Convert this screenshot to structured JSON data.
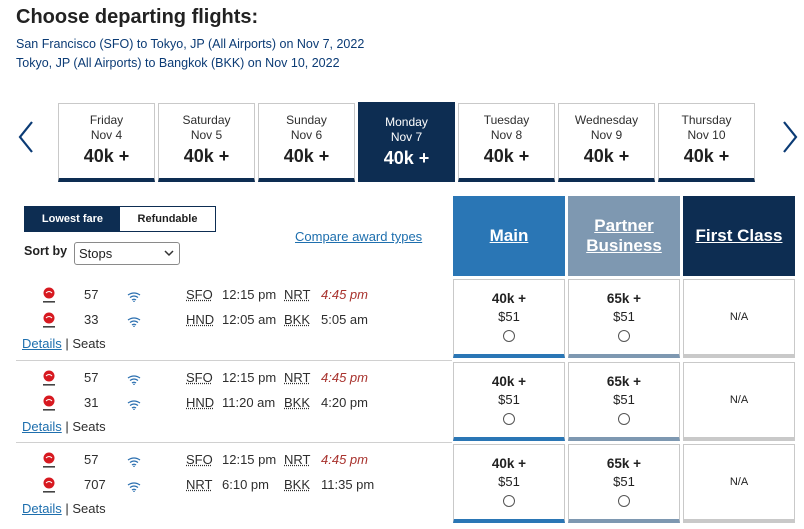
{
  "header": {
    "title": "Choose departing flights:",
    "route_1": "San Francisco (SFO) to Tokyo, JP (All Airports) on Nov 7, 2022",
    "route_2": "Tokyo, JP (All Airports) to Bangkok (BKK) on Nov 10, 2022"
  },
  "dates": [
    {
      "day": "Friday",
      "date": "Nov 4",
      "price": "40k +"
    },
    {
      "day": "Saturday",
      "date": "Nov 5",
      "price": "40k +"
    },
    {
      "day": "Sunday",
      "date": "Nov 6",
      "price": "40k +"
    },
    {
      "day": "Monday",
      "date": "Nov 7",
      "price": "40k +"
    },
    {
      "day": "Tuesday",
      "date": "Nov 8",
      "price": "40k +"
    },
    {
      "day": "Wednesday",
      "date": "Nov 9",
      "price": "40k +"
    },
    {
      "day": "Thursday",
      "date": "Nov 10",
      "price": "40k +"
    }
  ],
  "selected_date_index": 3,
  "fare_toggle": {
    "lowest": "Lowest fare",
    "refundable": "Refundable"
  },
  "sort": {
    "label": "Sort by",
    "value": "Stops"
  },
  "compare_link": "Compare award types",
  "columns": {
    "main": "Main",
    "partner_line1": "Partner",
    "partner_line2": "Business",
    "first": "First Class"
  },
  "links": {
    "details": "Details",
    "sep": " | ",
    "seats": "Seats"
  },
  "rows": [
    {
      "segments": [
        {
          "flight": "57",
          "from": "SFO",
          "dep": "12:15 pm",
          "to": "NRT",
          "arr": "4:45 pm",
          "arr_next_day": true
        },
        {
          "flight": "33",
          "from": "HND",
          "dep": "12:05 am",
          "to": "BKK",
          "arr": "5:05 am",
          "arr_next_day": false
        }
      ],
      "main": {
        "miles": "40k +",
        "tax": "$51"
      },
      "partner": {
        "miles": "65k +",
        "tax": "$51"
      },
      "first": "N/A"
    },
    {
      "segments": [
        {
          "flight": "57",
          "from": "SFO",
          "dep": "12:15 pm",
          "to": "NRT",
          "arr": "4:45 pm",
          "arr_next_day": true
        },
        {
          "flight": "31",
          "from": "HND",
          "dep": "11:20 am",
          "to": "BKK",
          "arr": "4:20 pm",
          "arr_next_day": false
        }
      ],
      "main": {
        "miles": "40k +",
        "tax": "$51"
      },
      "partner": {
        "miles": "65k +",
        "tax": "$51"
      },
      "first": "N/A"
    },
    {
      "segments": [
        {
          "flight": "57",
          "from": "SFO",
          "dep": "12:15 pm",
          "to": "NRT",
          "arr": "4:45 pm",
          "arr_next_day": true
        },
        {
          "flight": "707",
          "from": "NRT",
          "dep": "6:10 pm",
          "to": "BKK",
          "arr": "11:35 pm",
          "arr_next_day": false
        }
      ],
      "main": {
        "miles": "40k +",
        "tax": "$51"
      },
      "partner": {
        "miles": "65k +",
        "tax": "$51"
      },
      "first": "N/A"
    }
  ],
  "colors": {
    "navy": "#0d2d52",
    "main": "#2a76b5",
    "partner": "#7e98b1",
    "late": "#a8322d",
    "link": "#1e6fae"
  },
  "icons": {
    "airline": "jal-logo-icon",
    "wifi": "wifi-icon",
    "seat": "lie-flat-seat-icon",
    "prev": "chevron-left-icon",
    "next": "chevron-right-icon"
  }
}
